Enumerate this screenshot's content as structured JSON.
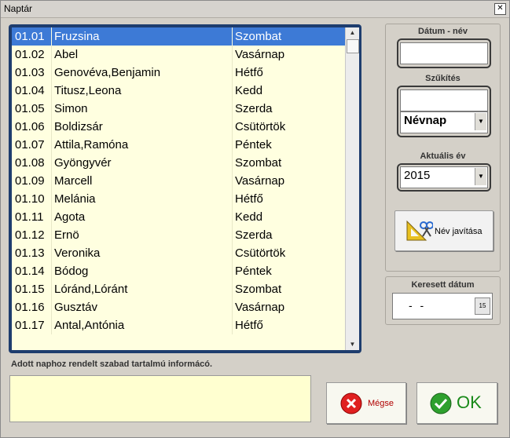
{
  "window": {
    "title": "Naptár",
    "close_glyph": "✕"
  },
  "list": {
    "rows": [
      {
        "date": "01.01",
        "name": "Fruzsina",
        "day": "Szombat",
        "selected": true
      },
      {
        "date": "01.02",
        "name": "Abel",
        "day": "Vasárnap"
      },
      {
        "date": "01.03",
        "name": "Genovéva,Benjamin",
        "day": "Hétfő"
      },
      {
        "date": "01.04",
        "name": "Titusz,Leona",
        "day": "Kedd"
      },
      {
        "date": "01.05",
        "name": "Simon",
        "day": "Szerda"
      },
      {
        "date": "01.06",
        "name": "Boldizsár",
        "day": "Csütörtök"
      },
      {
        "date": "01.07",
        "name": "Attila,Ramóna",
        "day": "Péntek"
      },
      {
        "date": "01.08",
        "name": "Gyöngyvér",
        "day": "Szombat"
      },
      {
        "date": "01.09",
        "name": "Marcell",
        "day": "Vasárnap"
      },
      {
        "date": "01.10",
        "name": "Melánia",
        "day": "Hétfő"
      },
      {
        "date": "01.11",
        "name": "Agota",
        "day": "Kedd"
      },
      {
        "date": "01.12",
        "name": "Ernö",
        "day": "Szerda"
      },
      {
        "date": "01.13",
        "name": "Veronika",
        "day": "Csütörtök"
      },
      {
        "date": "01.14",
        "name": "Bódog",
        "day": "Péntek"
      },
      {
        "date": "01.15",
        "name": "Lóránd,Lóránt",
        "day": "Szombat"
      },
      {
        "date": "01.16",
        "name": "Gusztáv",
        "day": "Vasárnap"
      },
      {
        "date": "01.17",
        "name": "Antal,Antónia",
        "day": "Hétfő"
      }
    ]
  },
  "info": {
    "label": "Adott naphoz rendelt szabad tartalmú informácó.",
    "value": ""
  },
  "right": {
    "datum_label": "Dátum - név",
    "datum_value": "",
    "szukites_label": "Szűkítés",
    "szukites_value": "",
    "szukites_select": "Névnap",
    "ev_label": "Aktuális év",
    "ev_select": "2015",
    "nev_button": "Név javítása",
    "keresett_label": "Keresett dátum",
    "keresett_value": "- -",
    "cal_glyph": "15"
  },
  "buttons": {
    "cancel": "Mégse",
    "ok": "OK"
  },
  "colors": {
    "selection": "#3d7ad6",
    "list_bg": "#ffffe0",
    "list_frame": "#1e3d6e",
    "cancel_red": "#e02020",
    "ok_green": "#2ea02e"
  },
  "icons": {
    "cancel": "x-circle-icon",
    "ok": "check-circle-icon",
    "edit": "ruler-scissors-icon"
  }
}
